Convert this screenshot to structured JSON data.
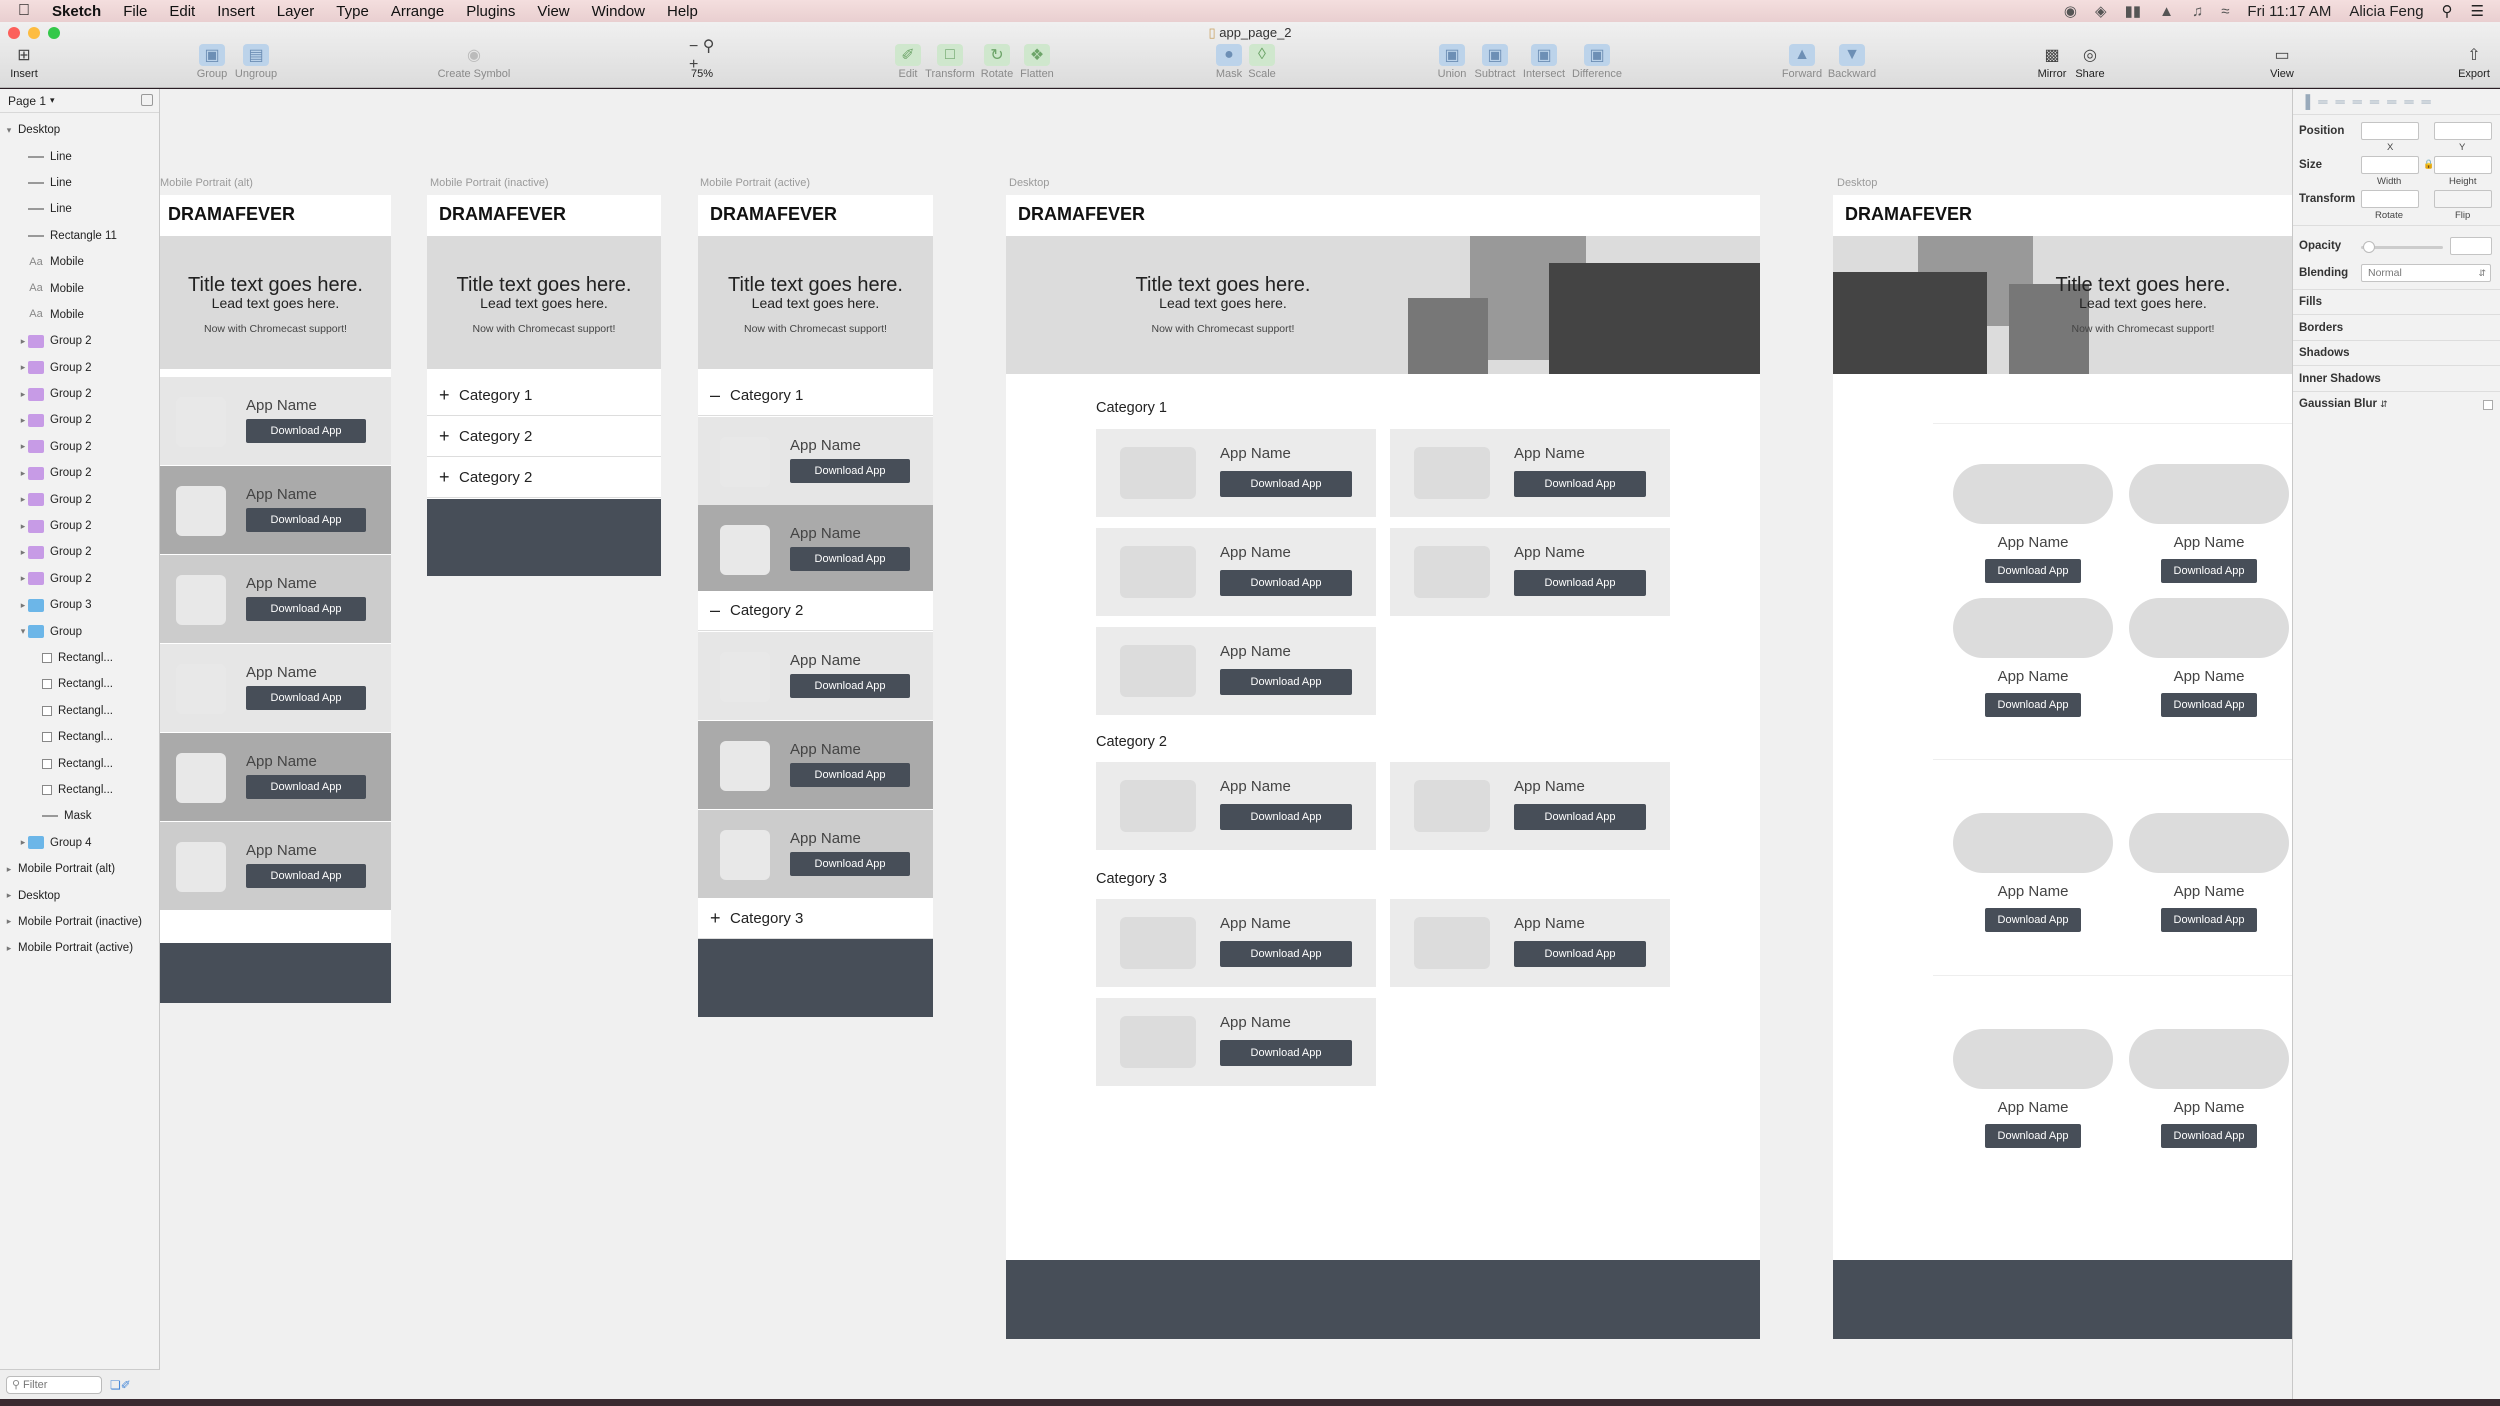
{
  "menubar": {
    "app": "Sketch",
    "items": [
      "File",
      "Edit",
      "Insert",
      "Layer",
      "Type",
      "Arrange",
      "Plugins",
      "View",
      "Window",
      "Help"
    ],
    "time": "Fri 11:17 AM",
    "user": "Alicia Feng"
  },
  "window": {
    "title": "app_page_2"
  },
  "toolbar": {
    "insert": "Insert",
    "group": "Group",
    "ungroup": "Ungroup",
    "create_symbol": "Create Symbol",
    "zoom": "75%",
    "edit": "Edit",
    "transform": "Transform",
    "rotate": "Rotate",
    "flatten": "Flatten",
    "mask": "Mask",
    "scale": "Scale",
    "union": "Union",
    "subtract": "Subtract",
    "intersect": "Intersect",
    "difference": "Difference",
    "forward": "Forward",
    "backward": "Backward",
    "mirror": "Mirror",
    "share": "Share",
    "view": "View",
    "export": "Export"
  },
  "layers": {
    "page": "Page 1",
    "filter_placeholder": "Filter",
    "items": [
      {
        "label": "Desktop",
        "indent": 0,
        "icon": "page",
        "expanded": true
      },
      {
        "label": "Line",
        "indent": 1,
        "icon": "line"
      },
      {
        "label": "Line",
        "indent": 1,
        "icon": "line"
      },
      {
        "label": "Line",
        "indent": 1,
        "icon": "line"
      },
      {
        "label": "Rectangle 11",
        "indent": 1,
        "icon": "line"
      },
      {
        "label": "Mobile",
        "indent": 1,
        "icon": "text"
      },
      {
        "label": "Mobile",
        "indent": 1,
        "icon": "text"
      },
      {
        "label": "Mobile",
        "indent": 1,
        "icon": "text"
      },
      {
        "label": "Group 2",
        "indent": 1,
        "icon": "folder-purple",
        "collapsed": true
      },
      {
        "label": "Group 2",
        "indent": 1,
        "icon": "folder-purple",
        "collapsed": true
      },
      {
        "label": "Group 2",
        "indent": 1,
        "icon": "folder-purple",
        "collapsed": true
      },
      {
        "label": "Group 2",
        "indent": 1,
        "icon": "folder-purple",
        "collapsed": true
      },
      {
        "label": "Group 2",
        "indent": 1,
        "icon": "folder-purple",
        "collapsed": true
      },
      {
        "label": "Group 2",
        "indent": 1,
        "icon": "folder-purple",
        "collapsed": true
      },
      {
        "label": "Group 2",
        "indent": 1,
        "icon": "folder-purple",
        "collapsed": true
      },
      {
        "label": "Group 2",
        "indent": 1,
        "icon": "folder-purple",
        "collapsed": true
      },
      {
        "label": "Group 2",
        "indent": 1,
        "icon": "folder-purple",
        "collapsed": true
      },
      {
        "label": "Group 2",
        "indent": 1,
        "icon": "folder-purple",
        "collapsed": true
      },
      {
        "label": "Group 3",
        "indent": 1,
        "icon": "folder-blue",
        "collapsed": true
      },
      {
        "label": "Group",
        "indent": 1,
        "icon": "folder-blue",
        "expanded": true
      },
      {
        "label": "Rectangl...",
        "indent": 2,
        "icon": "rect"
      },
      {
        "label": "Rectangl...",
        "indent": 2,
        "icon": "rect"
      },
      {
        "label": "Rectangl...",
        "indent": 2,
        "icon": "rect"
      },
      {
        "label": "Rectangl...",
        "indent": 2,
        "icon": "rect"
      },
      {
        "label": "Rectangl...",
        "indent": 2,
        "icon": "rect"
      },
      {
        "label": "Rectangl...",
        "indent": 2,
        "icon": "rect"
      },
      {
        "label": "Mask",
        "indent": 2,
        "icon": "line"
      },
      {
        "label": "Group 4",
        "indent": 1,
        "icon": "folder-blue",
        "collapsed": true
      },
      {
        "label": "Mobile Portrait (alt)",
        "indent": 0,
        "icon": "page",
        "collapsed": true
      },
      {
        "label": "Desktop",
        "indent": 0,
        "icon": "page",
        "collapsed": true
      },
      {
        "label": "Mobile Portrait (inactive)",
        "indent": 0,
        "icon": "page",
        "collapsed": true
      },
      {
        "label": "Mobile Portrait (active)",
        "indent": 0,
        "icon": "page",
        "collapsed": true
      }
    ]
  },
  "artboards": {
    "alt": {
      "label": "Mobile Portrait (alt)"
    },
    "inactive": {
      "label": "Mobile Portrait (inactive)"
    },
    "active": {
      "label": "Mobile Portrait (active)"
    },
    "desktop": {
      "label": "Desktop"
    },
    "desktop2": {
      "label": "Desktop"
    }
  },
  "common": {
    "brand": "DRAMAFEVER",
    "title": "Title text goes here.",
    "lead": "Lead text goes here.",
    "chromecast": "Now with Chromecast support!",
    "app_name": "App Name",
    "download": "Download App"
  },
  "categories": {
    "c1": "Category 1",
    "c2": "Category 2",
    "c3": "Category 3",
    "plus": "+",
    "minus": "–"
  },
  "inspector": {
    "position": "Position",
    "x": "X",
    "y": "Y",
    "size": "Size",
    "width": "Width",
    "height": "Height",
    "transform": "Transform",
    "rotate": "Rotate",
    "flip": "Flip",
    "opacity": "Opacity",
    "blending": "Blending",
    "blending_value": "Normal",
    "fills": "Fills",
    "borders": "Borders",
    "shadows": "Shadows",
    "inner_shadows": "Inner Shadows",
    "gaussian_blur": "Gaussian Blur"
  },
  "colors": {
    "dark": "#474e58",
    "canvas": "#f0f0f0",
    "hero": "#dadada"
  }
}
